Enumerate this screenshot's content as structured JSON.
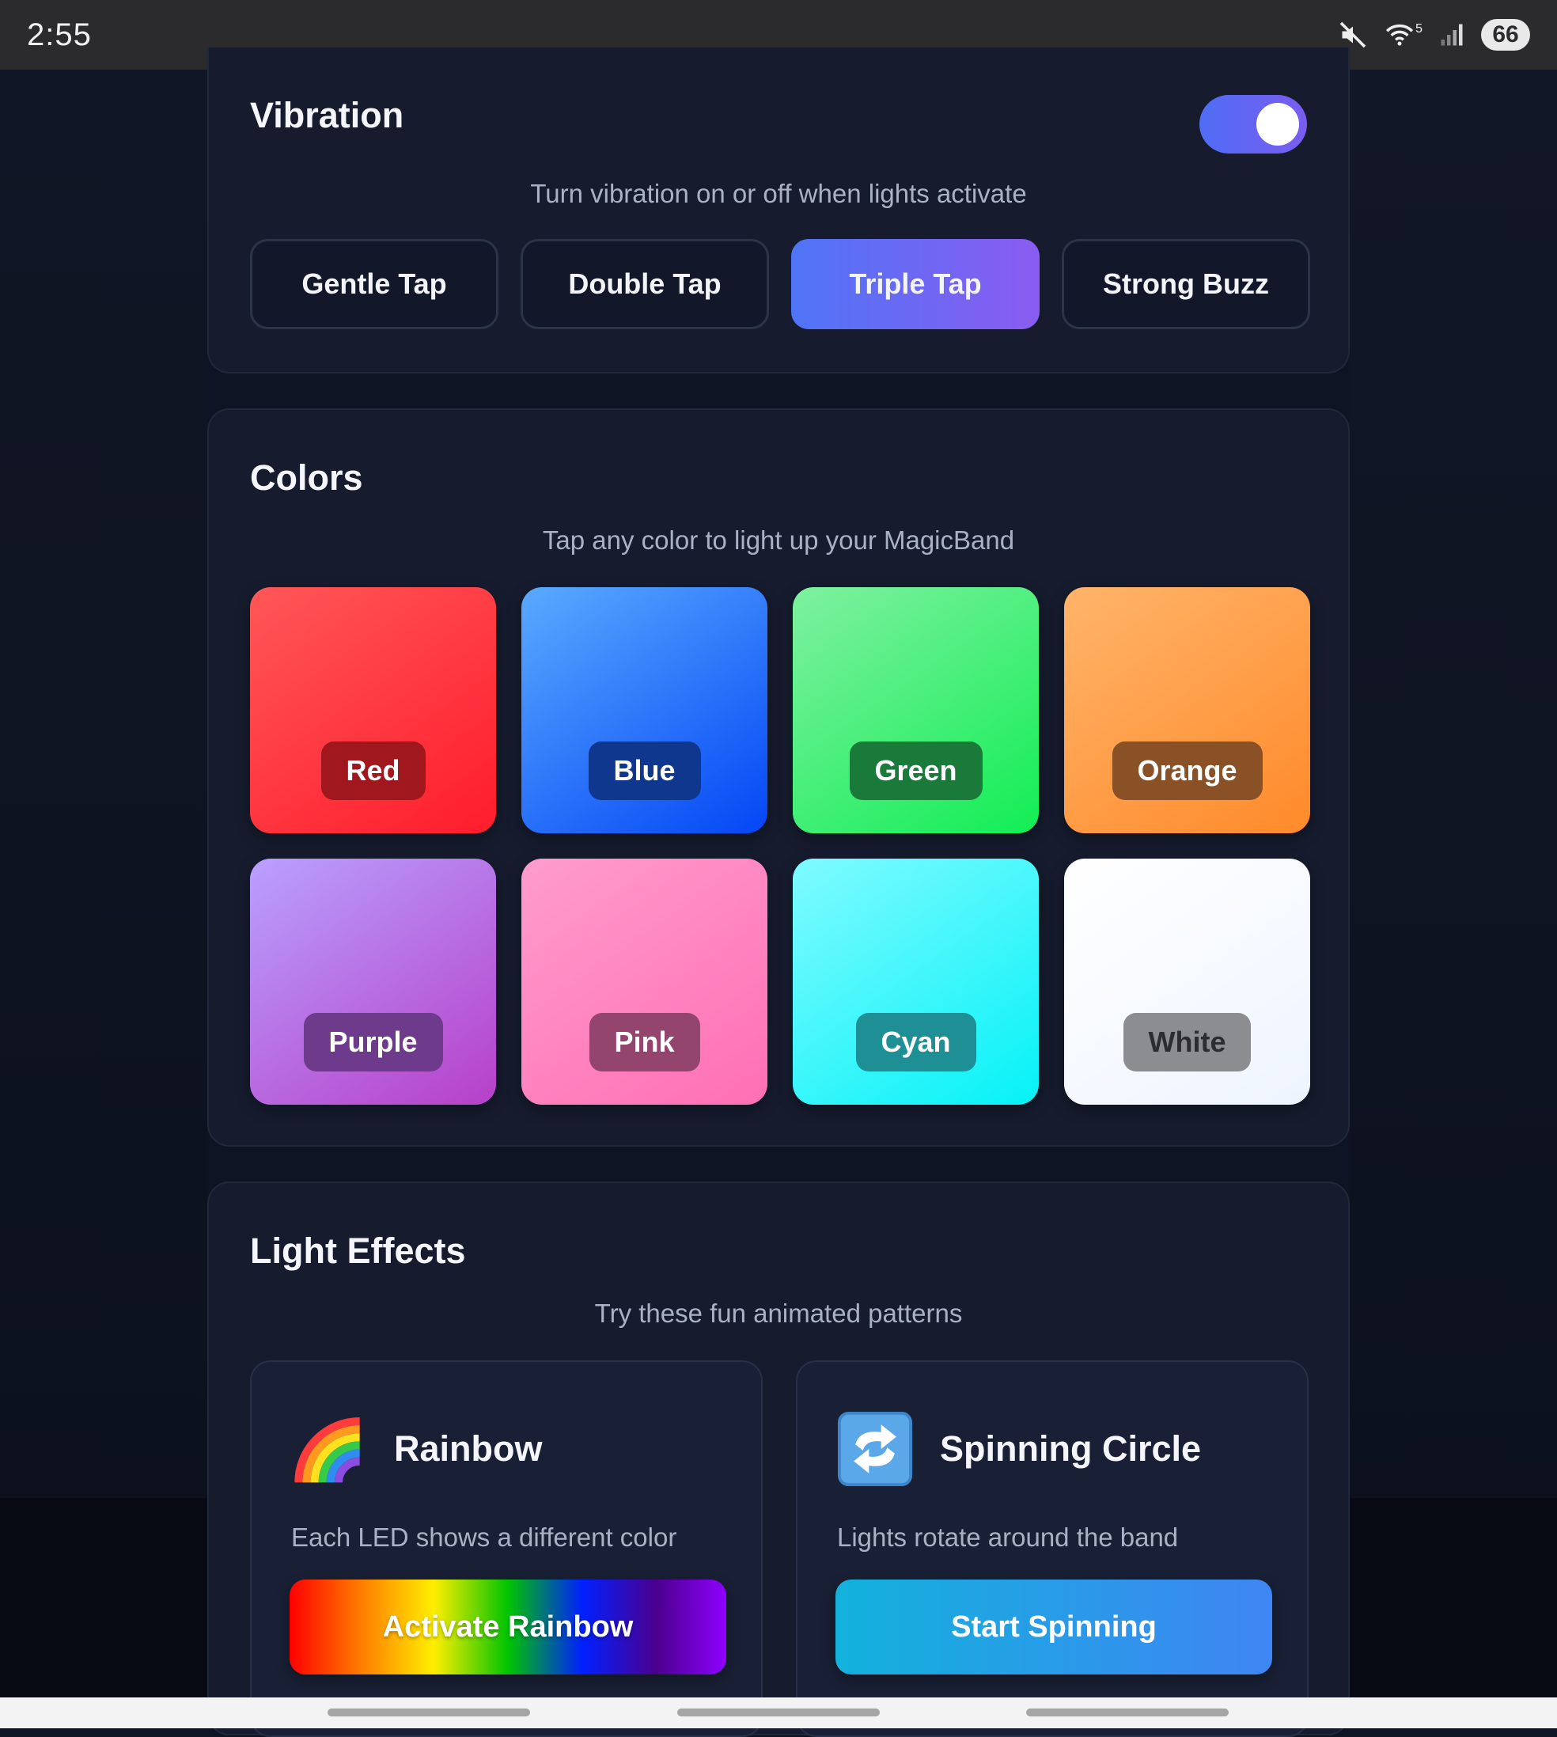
{
  "status_bar": {
    "time": "2:55",
    "wifi_label": "5",
    "battery": "66",
    "icons": [
      "mute-icon",
      "wifi-icon",
      "signal-icon",
      "battery-icon"
    ]
  },
  "vibration": {
    "title": "Vibration",
    "subtitle": "Turn vibration on or off when lights activate",
    "enabled": true,
    "patterns": [
      {
        "label": "Gentle Tap",
        "active": false
      },
      {
        "label": "Double Tap",
        "active": false
      },
      {
        "label": "Triple Tap",
        "active": true
      },
      {
        "label": "Strong Buzz",
        "active": false
      }
    ]
  },
  "colors": {
    "title": "Colors",
    "subtitle": "Tap any color to light up your MagicBand",
    "items": [
      {
        "label": "Red",
        "hex": "#ff2d3a"
      },
      {
        "label": "Blue",
        "hex": "#1f6bff"
      },
      {
        "label": "Green",
        "hex": "#2ef46a"
      },
      {
        "label": "Orange",
        "hex": "#ff9a45"
      },
      {
        "label": "Purple",
        "hex": "#b45fd6"
      },
      {
        "label": "Pink",
        "hex": "#ff82be"
      },
      {
        "label": "Cyan",
        "hex": "#2ef7fb"
      },
      {
        "label": "White",
        "hex": "#ffffff"
      }
    ]
  },
  "effects": {
    "title": "Light Effects",
    "subtitle": "Try these fun animated patterns",
    "items": [
      {
        "name": "Rainbow",
        "icon": "rainbow-icon",
        "description": "Each LED shows a different color",
        "button": "Activate Rainbow"
      },
      {
        "name": "Spinning Circle",
        "icon": "spinning-arrows-icon",
        "description": "Lights rotate around the band",
        "button": "Start Spinning"
      }
    ]
  },
  "accent_colors": {
    "toggle": "#5a66f4",
    "active_button": "#6c68f4",
    "card_bg": "#161c2e"
  }
}
